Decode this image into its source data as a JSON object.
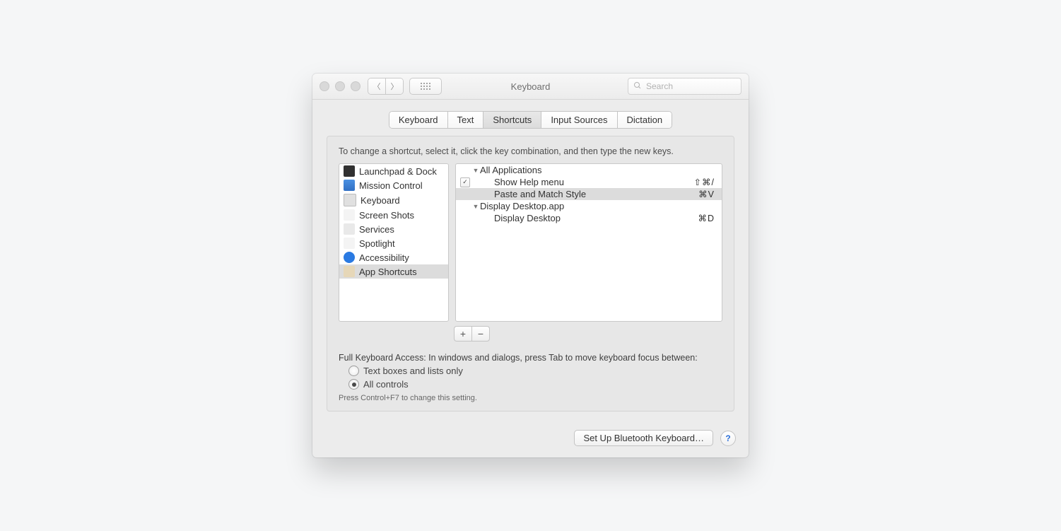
{
  "window": {
    "title": "Keyboard"
  },
  "toolbar": {
    "search_placeholder": "Search"
  },
  "tabs": {
    "items": [
      "Keyboard",
      "Text",
      "Shortcuts",
      "Input Sources",
      "Dictation"
    ],
    "selected_index": 2
  },
  "panel": {
    "instructions": "To change a shortcut, select it, click the key combination, and then type the new keys.",
    "categories": [
      {
        "label": "Launchpad & Dock",
        "icon": "launchpad-icon"
      },
      {
        "label": "Mission Control",
        "icon": "mission-control-icon"
      },
      {
        "label": "Keyboard",
        "icon": "keyboard-icon"
      },
      {
        "label": "Screen Shots",
        "icon": "screenshot-icon"
      },
      {
        "label": "Services",
        "icon": "services-icon"
      },
      {
        "label": "Spotlight",
        "icon": "spotlight-icon"
      },
      {
        "label": "Accessibility",
        "icon": "accessibility-icon"
      },
      {
        "label": "App Shortcuts",
        "icon": "app-shortcuts-icon"
      }
    ],
    "selected_category_index": 7,
    "shortcuts": [
      {
        "type": "group",
        "label": "All Applications",
        "expanded": true
      },
      {
        "type": "item",
        "label": "Show Help menu",
        "keys": "⇧⌘/",
        "checked": true,
        "selected": false
      },
      {
        "type": "item",
        "label": "Paste and Match Style",
        "keys": "⌘V",
        "checked": null,
        "selected": true
      },
      {
        "type": "group",
        "label": "Display Desktop.app",
        "expanded": true
      },
      {
        "type": "item",
        "label": "Display Desktop",
        "keys": "⌘D",
        "checked": null,
        "selected": false
      }
    ],
    "add_label": "+",
    "remove_label": "−",
    "fka_intro": "Full Keyboard Access: In windows and dialogs, press Tab to move keyboard focus between:",
    "fka_options": [
      "Text boxes and lists only",
      "All controls"
    ],
    "fka_selected_index": 1,
    "fka_hint": "Press Control+F7 to change this setting."
  },
  "footer": {
    "bluetooth_button": "Set Up Bluetooth Keyboard…",
    "help_label": "?"
  }
}
